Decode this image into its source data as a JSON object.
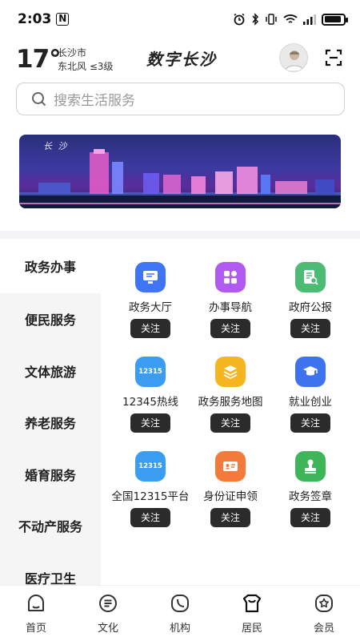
{
  "status_bar": {
    "time": "2:03",
    "nfc": "N"
  },
  "header": {
    "temperature": "17°",
    "city": "长沙市",
    "wind": "东北风  ≤3级",
    "brand": "数字长沙"
  },
  "search": {
    "placeholder": "搜索生活服务"
  },
  "banner": {
    "title": "长 沙"
  },
  "sidebar": {
    "items": [
      {
        "label": "政务办事",
        "active": true
      },
      {
        "label": "便民服务"
      },
      {
        "label": "文体旅游"
      },
      {
        "label": "养老服务"
      },
      {
        "label": "婚育服务"
      },
      {
        "label": "不动产服务"
      },
      {
        "label": "医疗卫生"
      }
    ]
  },
  "services": [
    {
      "label": "政务大厅",
      "follow": "关注",
      "color": "#3f74f4",
      "icon": "monitor-icon"
    },
    {
      "label": "办事导航",
      "follow": "关注",
      "color": "#b05af0",
      "icon": "grid-icon"
    },
    {
      "label": "政府公报",
      "follow": "关注",
      "color": "#4cbb73",
      "icon": "document-search-icon"
    },
    {
      "label": "12345热线",
      "follow": "关注",
      "color": "#3b9df2",
      "icon": "hotline-icon",
      "badge": "12315"
    },
    {
      "label": "政务服务地图",
      "follow": "关注",
      "color": "#f5b51f",
      "icon": "layers-icon"
    },
    {
      "label": "就业创业",
      "follow": "关注",
      "color": "#3e73f0",
      "icon": "graduation-cap-icon"
    },
    {
      "label": "全国12315平台",
      "follow": "关注",
      "color": "#3b9df2",
      "icon": "platform-icon",
      "badge": "12315"
    },
    {
      "label": "身份证申领",
      "follow": "关注",
      "color": "#f47a3c",
      "icon": "id-card-icon"
    },
    {
      "label": "政务签章",
      "follow": "关注",
      "color": "#3fb55a",
      "icon": "stamp-icon"
    }
  ],
  "tabbar": {
    "items": [
      {
        "label": "首页",
        "icon": "home-icon"
      },
      {
        "label": "文化",
        "icon": "culture-icon"
      },
      {
        "label": "机构",
        "icon": "institution-icon"
      },
      {
        "label": "居民",
        "icon": "resident-icon",
        "active": true
      },
      {
        "label": "会员",
        "icon": "member-icon"
      }
    ]
  },
  "colors": {
    "follow_button": "#2b2b2b",
    "sidebar_bg": "#f5f5f5",
    "banner_dark": "#2a2f7a"
  }
}
